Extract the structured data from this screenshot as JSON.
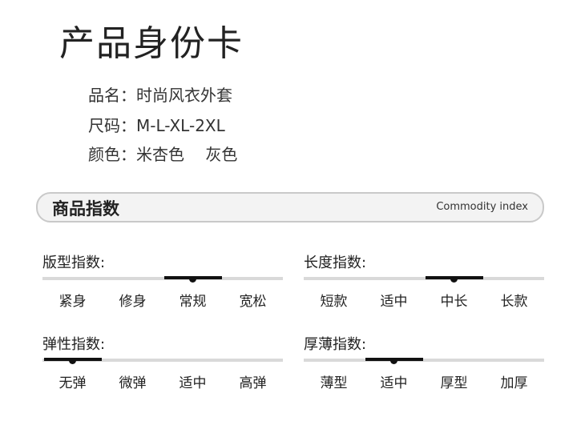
{
  "title": "产品身份卡",
  "info": [
    {
      "label": "品名：",
      "value": "时尚风衣外套"
    },
    {
      "label": "尺码：",
      "value": "M-L-XL-2XL"
    },
    {
      "label": "颜色：",
      "value": "米杏色　 灰色"
    }
  ],
  "banner": {
    "cn": "商品指数",
    "en": "Commodity index"
  },
  "indices": [
    {
      "label": "版型指数:",
      "options": [
        "紧身",
        "修身",
        "常规",
        "宽松"
      ],
      "selected": 2
    },
    {
      "label": "长度指数:",
      "options": [
        "短款",
        "适中",
        "中长",
        "长款"
      ],
      "selected": 2
    },
    {
      "label": "弹性指数:",
      "options": [
        "无弹",
        "微弹",
        "适中",
        "高弹"
      ],
      "selected": 0
    },
    {
      "label": "厚薄指数:",
      "options": [
        "薄型",
        "适中",
        "厚型",
        "加厚"
      ],
      "selected": 1
    }
  ]
}
